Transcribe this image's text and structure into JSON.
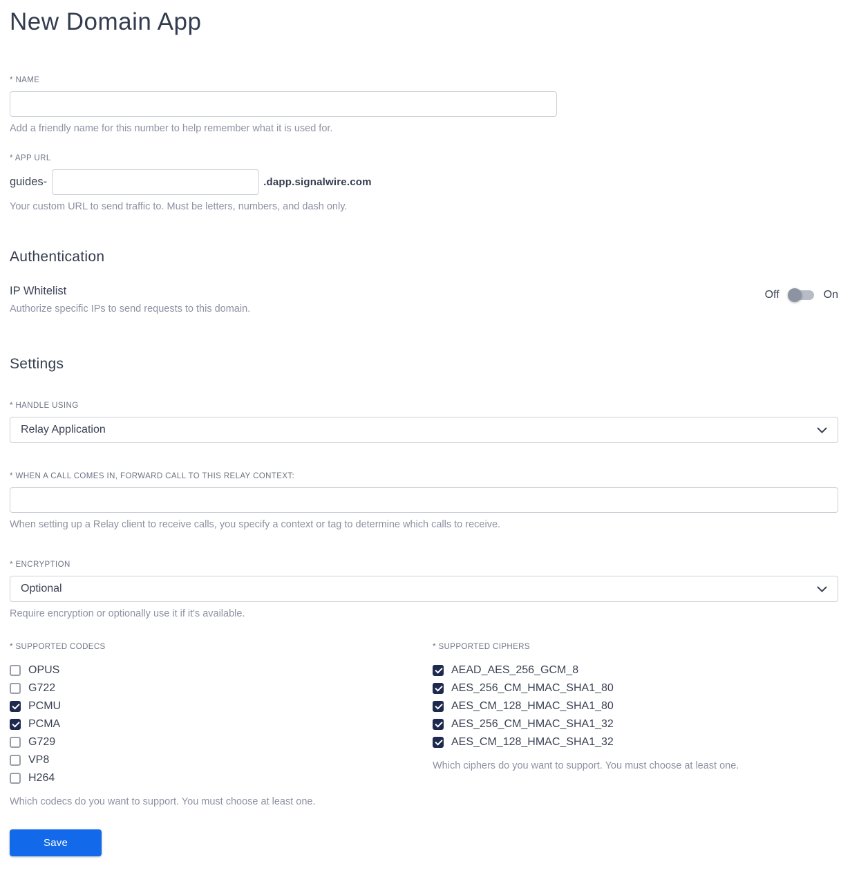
{
  "page": {
    "title": "New Domain App"
  },
  "name_field": {
    "label": "* NAME",
    "value": "",
    "help": "Add a friendly name for this number to help remember what it is used for."
  },
  "app_url": {
    "label": "* APP URL",
    "prefix": "guides-",
    "value": "",
    "suffix": ".dapp.signalwire.com",
    "help": "Your custom URL to send traffic to. Must be letters, numbers, and dash only."
  },
  "authentication": {
    "heading": "Authentication",
    "ip_whitelist": {
      "label": "IP Whitelist",
      "help": "Authorize specific IPs to send requests to this domain.",
      "off_label": "Off",
      "on_label": "On",
      "state": "off"
    }
  },
  "settings": {
    "heading": "Settings",
    "handle_using": {
      "label": "* HANDLE USING",
      "value": "Relay Application"
    },
    "relay_context": {
      "label": "* WHEN A CALL COMES IN, FORWARD CALL TO THIS RELAY CONTEXT:",
      "value": "",
      "help": "When setting up a Relay client to receive calls, you specify a context or tag to determine which calls to receive."
    },
    "encryption": {
      "label": "* ENCRYPTION",
      "value": "Optional",
      "help": "Require encryption or optionally use it if it's available."
    },
    "codecs": {
      "label": "* SUPPORTED CODECS",
      "items": [
        {
          "label": "OPUS",
          "checked": false
        },
        {
          "label": "G722",
          "checked": false
        },
        {
          "label": "PCMU",
          "checked": true
        },
        {
          "label": "PCMA",
          "checked": true
        },
        {
          "label": "G729",
          "checked": false
        },
        {
          "label": "VP8",
          "checked": false
        },
        {
          "label": "H264",
          "checked": false
        }
      ],
      "help": "Which codecs do you want to support. You must choose at least one."
    },
    "ciphers": {
      "label": "* SUPPORTED CIPHERS",
      "items": [
        {
          "label": "AEAD_AES_256_GCM_8",
          "checked": true
        },
        {
          "label": "AES_256_CM_HMAC_SHA1_80",
          "checked": true
        },
        {
          "label": "AES_CM_128_HMAC_SHA1_80",
          "checked": true
        },
        {
          "label": "AES_256_CM_HMAC_SHA1_32",
          "checked": true
        },
        {
          "label": "AES_CM_128_HMAC_SHA1_32",
          "checked": true
        }
      ],
      "help": "Which ciphers do you want to support. You must choose at least one."
    }
  },
  "save_label": "Save",
  "colors": {
    "accent_blue": "#1269ea",
    "checked_navy": "#1e2a4d",
    "heading_text": "#333c4e",
    "helper_text": "#8d92a2"
  }
}
